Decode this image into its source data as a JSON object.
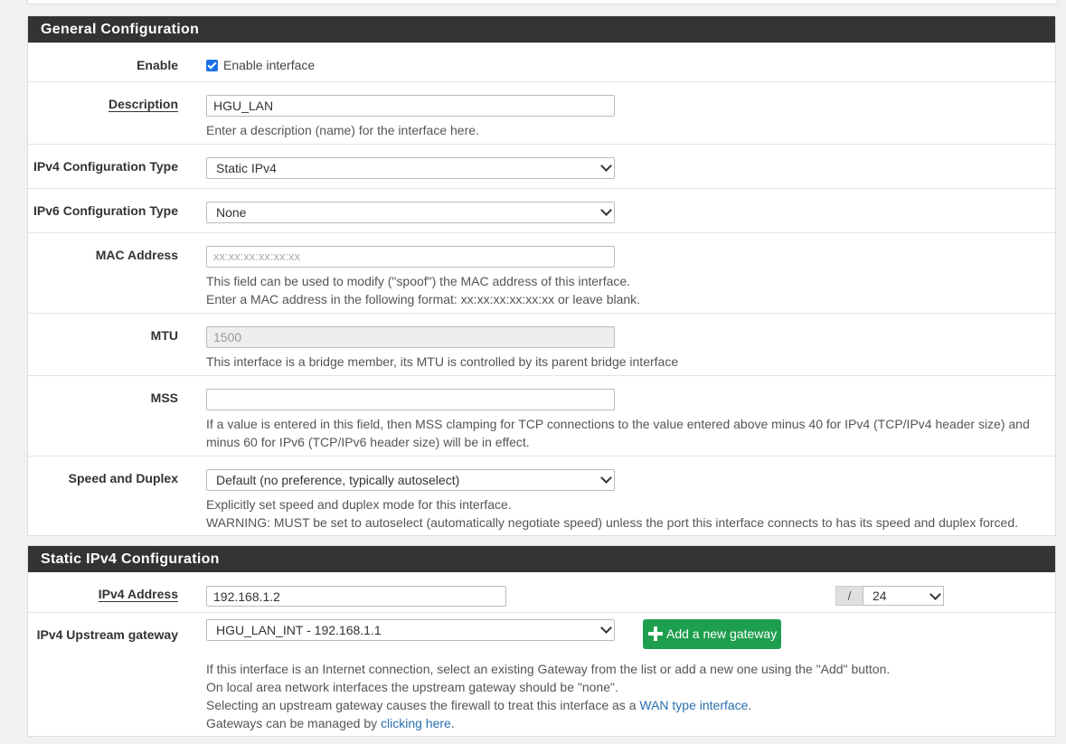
{
  "general": {
    "heading": "General Configuration",
    "enable": {
      "label": "Enable",
      "checkbox_label": "Enable interface",
      "checked": true
    },
    "description": {
      "label": "Description",
      "value": "HGU_LAN",
      "help": "Enter a description (name) for the interface here."
    },
    "ipv4_type": {
      "label": "IPv4 Configuration Type",
      "value": "Static IPv4"
    },
    "ipv6_type": {
      "label": "IPv6 Configuration Type",
      "value": "None"
    },
    "mac": {
      "label": "MAC Address",
      "placeholder": "xx:xx:xx:xx:xx:xx",
      "help1": "This field can be used to modify (\"spoof\") the MAC address of this interface.",
      "help2": "Enter a MAC address in the following format: xx:xx:xx:xx:xx:xx or leave blank."
    },
    "mtu": {
      "label": "MTU",
      "value": "1500",
      "help": "This interface is a bridge member, its MTU is controlled by its parent bridge interface"
    },
    "mss": {
      "label": "MSS",
      "value": "",
      "help1": "If a value is entered in this field, then MSS clamping for TCP connections to the value entered above minus 40 for IPv4 (TCP/IPv4 header size) and",
      "help2": "minus 60 for IPv6 (TCP/IPv6 header size) will be in effect."
    },
    "speed": {
      "label": "Speed and Duplex",
      "value": "Default (no preference, typically autoselect)",
      "help1": "Explicitly set speed and duplex mode for this interface.",
      "help2": "WARNING: MUST be set to autoselect (automatically negotiate speed) unless the port this interface connects to has its speed and duplex forced."
    }
  },
  "static_ipv4": {
    "heading": "Static IPv4 Configuration",
    "address": {
      "label": "IPv4 Address",
      "value": "192.168.1.2",
      "slash": "/",
      "mask": "24"
    },
    "gateway": {
      "label": "IPv4 Upstream gateway",
      "value": "HGU_LAN_INT - 192.168.1.1",
      "add_button": "Add a new gateway",
      "help1": "If this interface is an Internet connection, select an existing Gateway from the list or add a new one using the \"Add\" button.",
      "help2": "On local area network interfaces the upstream gateway should be \"none\".",
      "help3_pre": "Selecting an upstream gateway causes the firewall to treat this interface as a ",
      "help3_link": "WAN type interface",
      "help3_post": ".",
      "help4_pre": "Gateways can be managed by ",
      "help4_link": "clicking here",
      "help4_post": "."
    }
  }
}
